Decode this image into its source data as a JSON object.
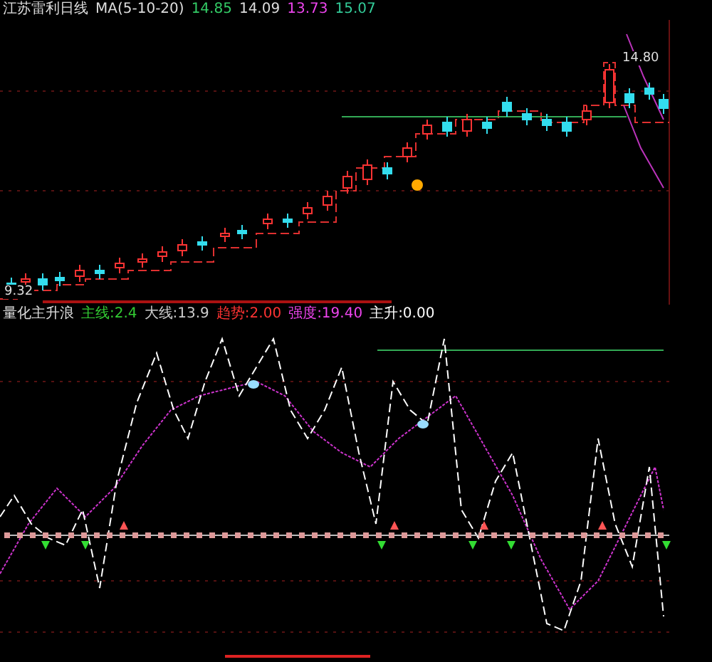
{
  "price_panel": {
    "title": "江苏雷利日线",
    "indicator": "MA(5-10-20)",
    "readings": [
      {
        "text": "14.85",
        "color": "#33cc66"
      },
      {
        "text": "14.09",
        "color": "#dddddd"
      },
      {
        "text": "13.73",
        "color": "#ee44ee"
      },
      {
        "text": "15.07",
        "color": "#33cc99"
      }
    ],
    "high_label": "14.80",
    "low_label": "9.32"
  },
  "indicator_panel": {
    "title": "量化主升浪",
    "readings": [
      {
        "label": "主线:",
        "value": "2.4",
        "color": "#33cc33"
      },
      {
        "label": "大线:",
        "value": "13.9",
        "color": "#cccccc"
      },
      {
        "label": "趋势:",
        "value": "2.00",
        "color": "#ff3333"
      },
      {
        "label": "强度:",
        "value": "19.40",
        "color": "#ee44ee"
      },
      {
        "label": "主升:",
        "value": "0.00",
        "color": "#ffffff"
      }
    ]
  }
}
